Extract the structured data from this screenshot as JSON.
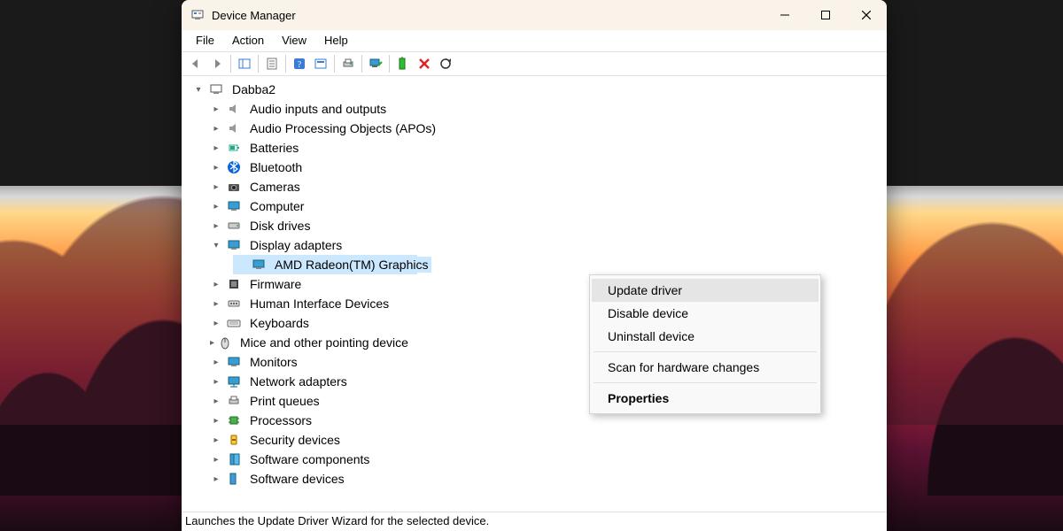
{
  "window": {
    "title": "Device Manager"
  },
  "menubar": [
    "File",
    "Action",
    "View",
    "Help"
  ],
  "toolbar_icons": [
    "back-icon",
    "forward-icon",
    "show-hide-console-icon",
    "properties-icon",
    "help-icon",
    "action-icon",
    "print-icon",
    "monitor-icon",
    "enable-icon",
    "disable-icon",
    "scan-icon"
  ],
  "tree": {
    "root": "Dabba2",
    "categories": [
      {
        "label": "Audio inputs and outputs",
        "icon": "speaker-icon"
      },
      {
        "label": "Audio Processing Objects (APOs)",
        "icon": "speaker-icon"
      },
      {
        "label": "Batteries",
        "icon": "battery-icon"
      },
      {
        "label": "Bluetooth",
        "icon": "bluetooth-icon"
      },
      {
        "label": "Cameras",
        "icon": "camera-icon"
      },
      {
        "label": "Computer",
        "icon": "computer-icon"
      },
      {
        "label": "Disk drives",
        "icon": "disk-icon"
      },
      {
        "label": "Display adapters",
        "icon": "monitor-icon",
        "expanded": true,
        "children": [
          {
            "label": "AMD Radeon(TM) Graphics",
            "icon": "monitor-icon",
            "selected": true
          }
        ]
      },
      {
        "label": "Firmware",
        "icon": "firmware-icon"
      },
      {
        "label": "Human Interface Devices",
        "icon": "hid-icon"
      },
      {
        "label": "Keyboards",
        "icon": "keyboard-icon"
      },
      {
        "label": "Mice and other pointing devices",
        "icon": "mouse-icon",
        "truncated": true
      },
      {
        "label": "Monitors",
        "icon": "monitor-icon"
      },
      {
        "label": "Network adapters",
        "icon": "network-icon"
      },
      {
        "label": "Print queues",
        "icon": "printer-icon"
      },
      {
        "label": "Processors",
        "icon": "cpu-icon"
      },
      {
        "label": "Security devices",
        "icon": "security-icon"
      },
      {
        "label": "Software components",
        "icon": "software-icon"
      },
      {
        "label": "Software devices",
        "icon": "software-icon"
      }
    ]
  },
  "context_menu": {
    "items": [
      {
        "label": "Update driver",
        "highlight": true
      },
      {
        "label": "Disable device"
      },
      {
        "label": "Uninstall device"
      },
      {
        "separator": true
      },
      {
        "label": "Scan for hardware changes"
      },
      {
        "separator": true
      },
      {
        "label": "Properties",
        "bold": true
      }
    ]
  },
  "statusbar": "Launches the Update Driver Wizard for the selected device."
}
